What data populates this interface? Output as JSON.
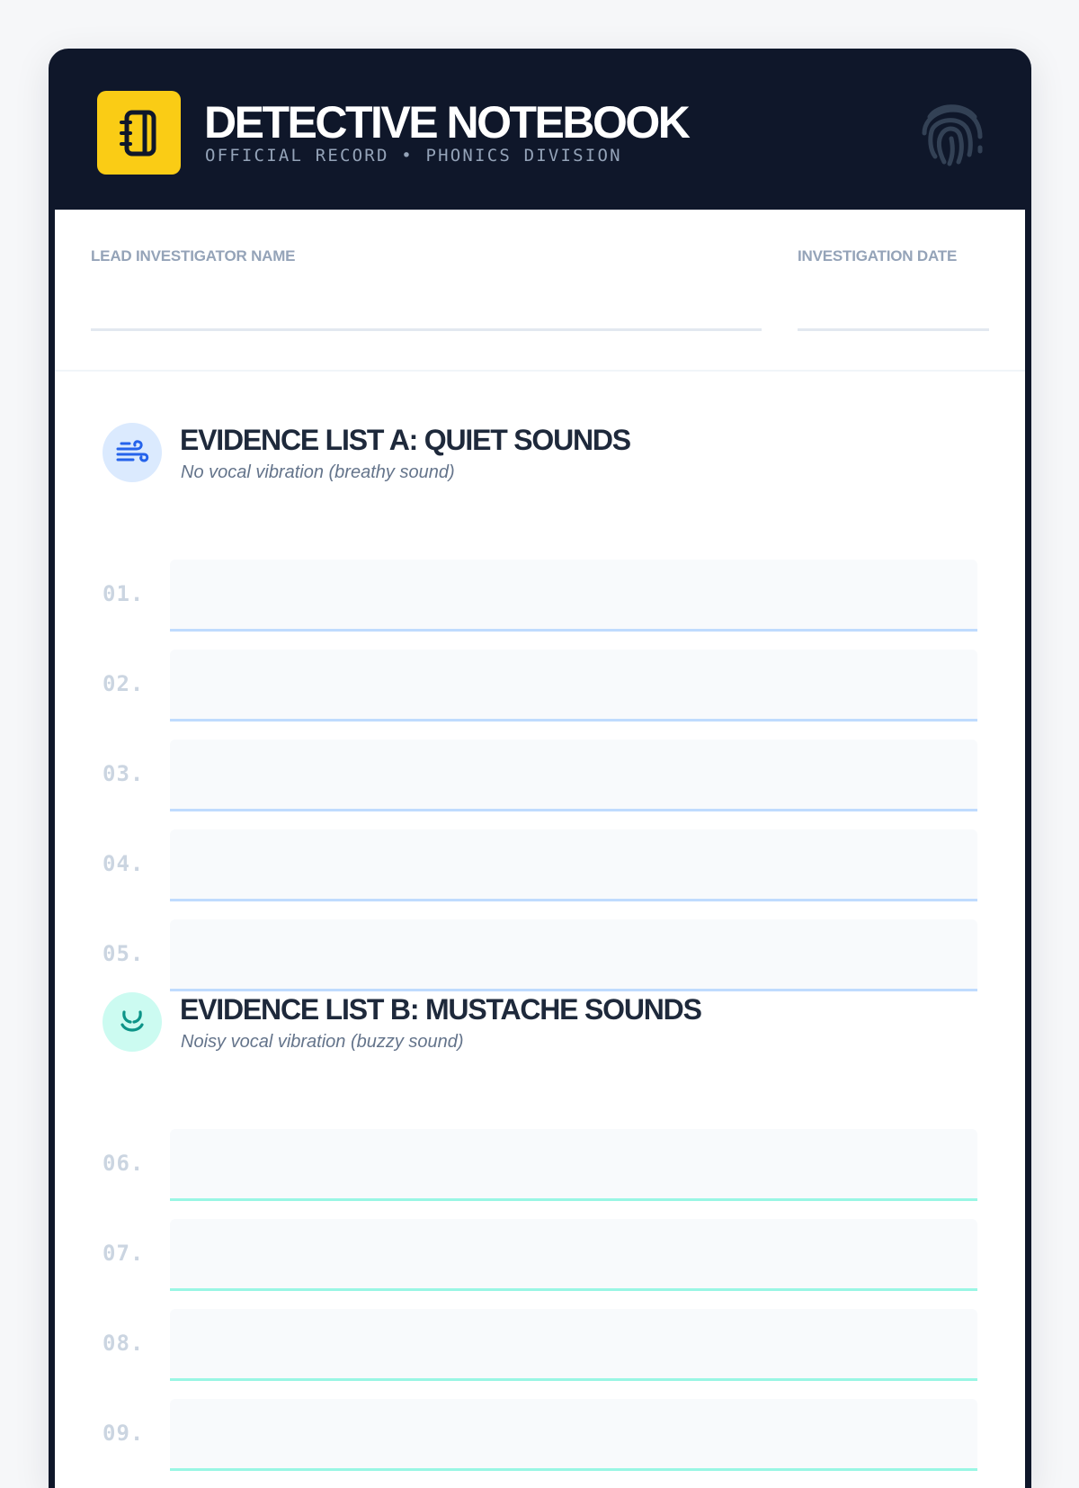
{
  "header": {
    "title": "DETECTIVE NOTEBOOK",
    "subtitle": "OFFICIAL RECORD • PHONICS DIVISION",
    "logo_icon": "notebook-icon",
    "decor_icon": "fingerprint-icon",
    "accent": "#facc15",
    "background": "#0f172a"
  },
  "meta": {
    "name_label": "LEAD INVESTIGATOR NAME",
    "date_label": "INVESTIGATION DATE",
    "name_value": "",
    "date_value": ""
  },
  "sections": [
    {
      "title": "EVIDENCE LIST A: QUIET SOUNDS",
      "subtitle": "No vocal vibration (breathy sound)",
      "icon": "wind-icon",
      "color": "#3b82f6",
      "rows": [
        "01.",
        "02.",
        "03.",
        "04.",
        "05."
      ]
    },
    {
      "title": "EVIDENCE LIST B: MUSTACHE SOUNDS",
      "subtitle": "Noisy vocal vibration (buzzy sound)",
      "icon": "mustache-icon",
      "color": "#14b8a6",
      "rows": [
        "06.",
        "07.",
        "08.",
        "09."
      ]
    }
  ]
}
